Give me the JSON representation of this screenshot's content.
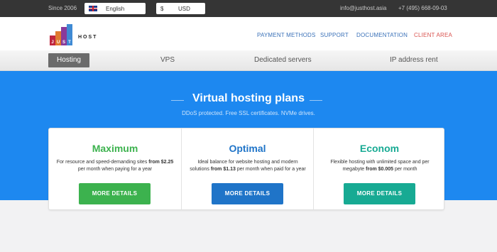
{
  "topbar": {
    "since": "Since 2006",
    "language": "English",
    "currency_symbol": "$",
    "currency": "USD",
    "email": "info@justhost.asia",
    "phone": "+7 (495) 668-09-03"
  },
  "header": {
    "logo_letters": [
      "J",
      "U",
      "S",
      "T"
    ],
    "logo_host": "HOST",
    "nav": [
      {
        "label": "PAYMENT METHODS"
      },
      {
        "label": "SUPPORT"
      },
      {
        "label": "DOCUMENTATION"
      },
      {
        "label": "CLIENT AREA"
      }
    ]
  },
  "tabs": [
    {
      "label": "Hosting",
      "active": true
    },
    {
      "label": "VPS"
    },
    {
      "label": "Dedicated servers"
    },
    {
      "label": "IP address rent"
    }
  ],
  "hero": {
    "title": "Virtual hosting plans",
    "subtitle": "DDoS protected. Free SSL certificates. NVMe drives."
  },
  "plans": [
    {
      "name": "Maximum",
      "desc_prefix": "For resource and speed-demanding sites ",
      "desc_price": "from $2.25",
      "desc_suffix": " per month when paying for a year",
      "button": "MORE DETAILS",
      "color": "#3cb24e"
    },
    {
      "name": "Optimal",
      "desc_prefix": "Ideal balance for website hosting and modern solutions ",
      "desc_price": "from $1.13",
      "desc_suffix": " per month when paid for a year",
      "button": "MORE DETAILS",
      "color": "#1f74c8"
    },
    {
      "name": "Econom",
      "desc_prefix": "Flexible hosting with unlimited space and per megabyte ",
      "desc_price": "from $0.005",
      "desc_suffix": " per month",
      "button": "MORE DETAILS",
      "color": "#17aa93"
    }
  ],
  "colors": {
    "hero_bg": "#1d88f0",
    "topbar_bg": "#353535",
    "nav_link": "#3a71b8",
    "client_area": "#d9534f"
  }
}
